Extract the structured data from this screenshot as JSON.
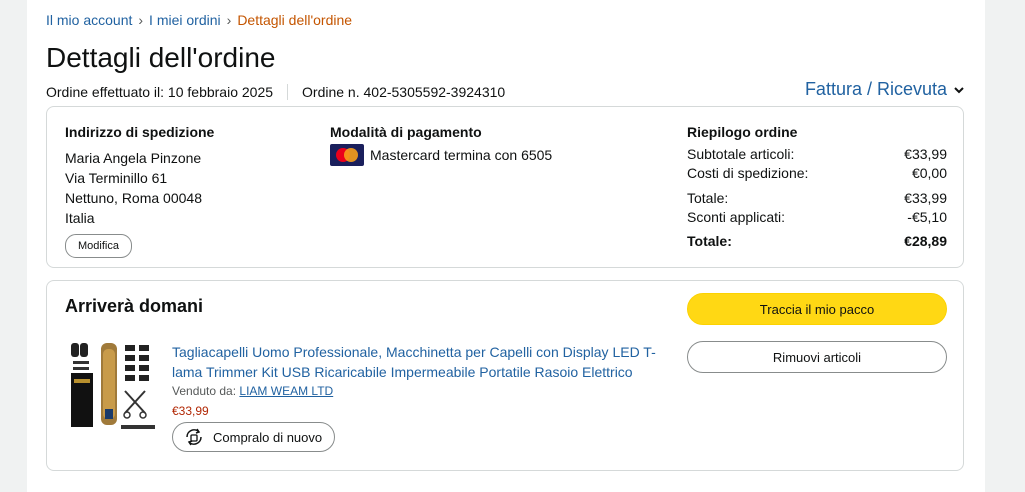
{
  "breadcrumb": {
    "items": [
      "Il mio account",
      "I miei ordini"
    ],
    "current": "Dettagli dell'ordine",
    "separator": "›"
  },
  "page": {
    "title": "Dettagli dell'ordine",
    "order_date": "Ordine effettuato il: 10 febbraio 2025",
    "order_number": "Ordine n. 402-5305592-3924310",
    "invoice_label": "Fattura / Ricevuta"
  },
  "shipping": {
    "heading": "Indirizzo di spedizione",
    "lines": [
      "Maria Angela Pinzone",
      "Via Terminillo 61",
      "Nettuno, Roma 00048",
      "Italia"
    ],
    "edit_label": "Modifica"
  },
  "payment": {
    "heading": "Modalità di pagamento",
    "method": "Mastercard",
    "ending": "termina con 6505"
  },
  "summary": {
    "heading": "Riepilogo ordine",
    "subtotal_label": "Subtotale articoli:",
    "subtotal_value": "€33,99",
    "shipping_label": "Costi di spedizione:",
    "shipping_value": "€0,00",
    "total_label": "Totale:",
    "total_value": "€33,99",
    "discount_label": "Sconti applicati:",
    "discount_value": "-€5,10",
    "grand_total_label": "Totale:",
    "grand_total_value": "€28,89"
  },
  "shipment": {
    "heading": "Arriverà domani",
    "track_label": "Traccia il mio pacco",
    "remove_label": "Rimuovi articoli",
    "product": {
      "title": "Tagliacapelli Uomo Professionale, Macchinetta per Capelli con Display LED T-lama Trimmer Kit USB Ricaricabile Impermeabile Portatile Rasoio Elettrico",
      "seller_prefix": "Venduto da:",
      "seller_name": "LIAM WEAM LTD",
      "price": "€33,99",
      "buy_again_label": "Compralo di nuovo"
    }
  },
  "colors": {
    "link": "#2162a1",
    "breadcrumb_current": "#c45500",
    "price": "#b12704",
    "primary_button": "#ffd814"
  },
  "icons": {
    "invoice_chevron": "chevron-down-icon",
    "buy_again": "repeat-bag-icon",
    "payment": "mastercard-logo-icon"
  }
}
